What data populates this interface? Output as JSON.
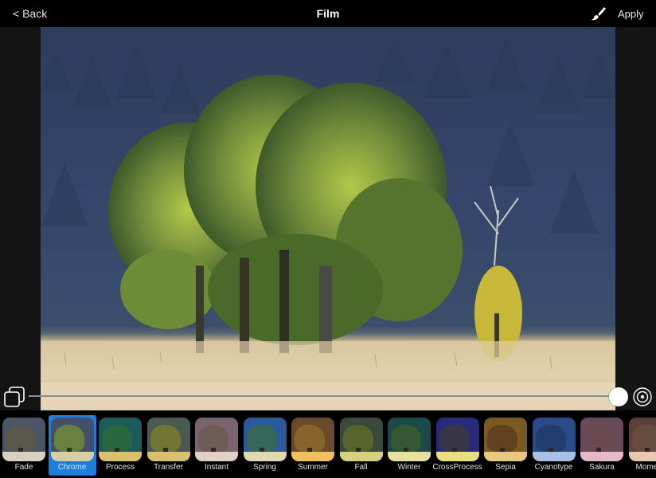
{
  "header": {
    "back_label": "< Back",
    "title": "Film",
    "apply_label": "Apply",
    "brush_icon": "paintbrush-icon"
  },
  "editor": {
    "compare_icon": "compare-layers-icon",
    "target_icon": "target-icon",
    "intensity": 1.0
  },
  "filters": [
    {
      "label": "Fade",
      "selected": false,
      "sky": "#4a5566",
      "tree": "#5a5a48",
      "ground": "#d8d0c0"
    },
    {
      "label": "Chrome",
      "selected": true,
      "sky": "#42506a",
      "tree": "#6f8a3a",
      "ground": "#d6cfa6"
    },
    {
      "label": "Process",
      "selected": false,
      "sky": "#1e5a5a",
      "tree": "#2b6a3a",
      "ground": "#d8c070"
    },
    {
      "label": "Transfer",
      "selected": false,
      "sky": "#4a5a50",
      "tree": "#7a7a30",
      "ground": "#d8c070"
    },
    {
      "label": "Instant",
      "selected": false,
      "sky": "#7a6470",
      "tree": "#6a5a50",
      "ground": "#e0d0c8"
    },
    {
      "label": "Spring",
      "selected": false,
      "sky": "#2a5a9a",
      "tree": "#3a6a50",
      "ground": "#e0d8b0"
    },
    {
      "label": "Summer",
      "selected": false,
      "sky": "#6a4a2a",
      "tree": "#8a6a2a",
      "ground": "#f0c060"
    },
    {
      "label": "Fall",
      "selected": false,
      "sky": "#3a4a3a",
      "tree": "#5a6a2a",
      "ground": "#d8d080"
    },
    {
      "label": "Winter",
      "selected": false,
      "sky": "#1a4a4a",
      "tree": "#3a5a30",
      "ground": "#e8e0a0"
    },
    {
      "label": "CrossProcess",
      "selected": false,
      "sky": "#2a2a7a",
      "tree": "#3a3a40",
      "ground": "#e8e080"
    },
    {
      "label": "Sepia",
      "selected": false,
      "sky": "#7a5a20",
      "tree": "#5a4020",
      "ground": "#e8c880"
    },
    {
      "label": "Cyanotype",
      "selected": false,
      "sky": "#2a4a8a",
      "tree": "#203a6a",
      "ground": "#a8c0e8"
    },
    {
      "label": "Sakura",
      "selected": false,
      "sky": "#6a4a58",
      "tree": "#6a4a50",
      "ground": "#e8b8c8"
    },
    {
      "label": "Moment",
      "selected": false,
      "sky": "#5a4038",
      "tree": "#6a5040",
      "ground": "#e8c8b0"
    }
  ]
}
